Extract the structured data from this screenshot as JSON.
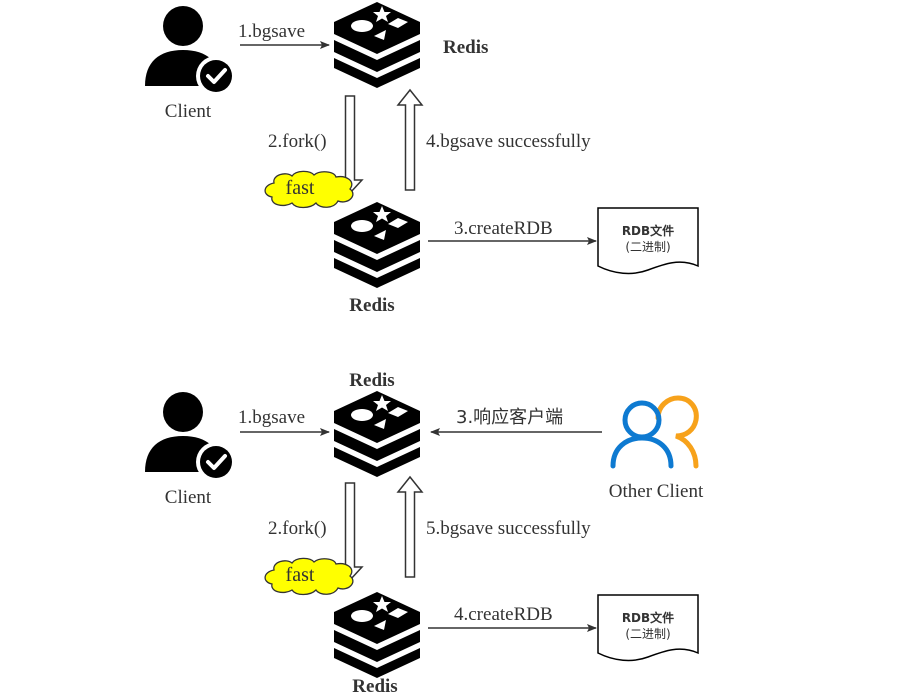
{
  "colors": {
    "text": "#333333",
    "line": "#333333",
    "icon": "#000000",
    "cloud_fill": "#ffff00",
    "cloud_stroke": "#333333",
    "other_client_blue": "#0e7ad1",
    "other_client_orange": "#f7a21b"
  },
  "top": {
    "client_label": "Client",
    "redis_main_label": "Redis",
    "redis_child_label": "Redis",
    "edge_bgsave": "1.bgsave",
    "edge_fork": "2.fork()",
    "edge_create_rdb": "3.createRDB",
    "edge_success": "4.bgsave successfully",
    "cloud_label": "fast",
    "rdb_file": {
      "line1": "RDB文件",
      "line2": "(二进制)"
    }
  },
  "bottom": {
    "client_label": "Client",
    "redis_main_label": "Redis",
    "redis_child_label": "Redis",
    "other_client_label": "Other Client",
    "edge_bgsave": "1.bgsave",
    "edge_fork": "2.fork()",
    "edge_respond": "3.响应客户端",
    "edge_create_rdb": "4.createRDB",
    "edge_success": "5.bgsave successfully",
    "cloud_label": "fast",
    "rdb_file": {
      "line1": "RDB文件",
      "line2": "(二进制)"
    }
  }
}
